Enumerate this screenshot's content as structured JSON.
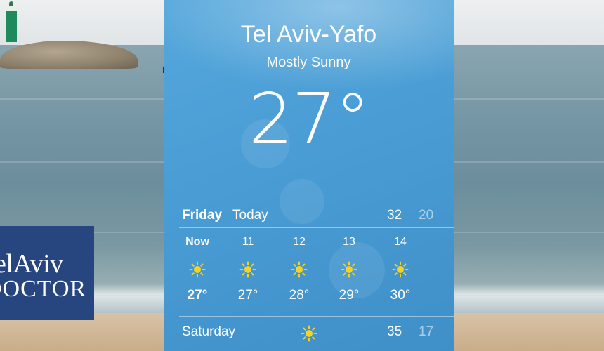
{
  "weather": {
    "city": "Tel Aviv-Yafo",
    "condition": "Mostly Sunny",
    "current_temp": "27°",
    "days": [
      {
        "name": "Friday",
        "label": "Today",
        "high": "32",
        "low": "20"
      },
      {
        "name": "Saturday",
        "label": "",
        "high": "35",
        "low": "17"
      }
    ],
    "hourly": [
      {
        "time": "Now",
        "temp": "27°",
        "icon": "sun-icon"
      },
      {
        "time": "11",
        "temp": "27°",
        "icon": "sun-icon"
      },
      {
        "time": "12",
        "temp": "28°",
        "icon": "sun-icon"
      },
      {
        "time": "13",
        "temp": "29°",
        "icon": "sun-icon"
      },
      {
        "time": "14",
        "temp": "30°",
        "icon": "sun-icon"
      }
    ]
  },
  "logo": {
    "line1": "TelAviv",
    "line2": "DOCTOR"
  },
  "colors": {
    "panel_blue": "#4c9fd6",
    "sun_yellow": "#f7d21e",
    "logo_navy": "#27467f"
  }
}
